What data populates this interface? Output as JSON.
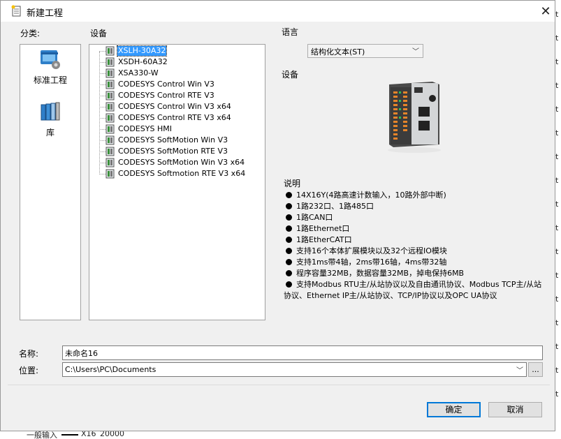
{
  "window": {
    "title": "新建工程"
  },
  "labels": {
    "category": "分类:",
    "device": "设备",
    "language": "语言",
    "device_preview": "设备",
    "name": "名称:",
    "location": "位置:"
  },
  "categories": [
    {
      "label": "标准工程",
      "icon": "standard-project-icon"
    },
    {
      "label": "库",
      "icon": "library-books-icon"
    }
  ],
  "devices": [
    "XSLH-30A32",
    "XSDH-60A32",
    "XSA330-W",
    "CODESYS Control Win V3",
    "CODESYS Control RTE V3",
    "CODESYS Control Win V3 x64",
    "CODESYS Control RTE V3 x64",
    "CODESYS HMI",
    "CODESYS SoftMotion Win V3",
    "CODESYS SoftMotion RTE V3",
    "CODESYS SoftMotion Win V3 x64",
    "CODESYS Softmotion RTE V3 x64"
  ],
  "selected_device": "XSLH-30A32",
  "language_select": {
    "value": "结构化文本(ST)"
  },
  "description": {
    "title": "说明",
    "bullets": [
      "14X16Y(4路高速计数输入，10路外部中断)",
      "1路232口、1路485口",
      "1路CAN口",
      "1路Ethernet口",
      "1路EtherCAT口",
      "支持16个本体扩展模块以及32个远程IO模块",
      "支持1ms带4轴，2ms带16轴，4ms带32轴",
      "程序容量32MB，数据容量32MB，掉电保持6MB",
      "支持Modbus RTU主/从站协议以及自由通讯协议、Modbus TCP主/从站协议、Ethernet IP主/从站协议、TCP/IP协议以及OPC UA协议"
    ]
  },
  "name_field": {
    "value": "未命名16"
  },
  "location_field": {
    "value": "C:\\Users\\PC\\Documents"
  },
  "buttons": {
    "browse": "...",
    "ok": "确定",
    "cancel": "取消"
  },
  "background": {
    "right_edge": [
      "t",
      "t",
      "t",
      "t",
      "t",
      "t",
      "t",
      "t",
      "t",
      "t",
      "t",
      "t",
      "t",
      "t",
      "t",
      "t",
      "t"
    ],
    "bottom": [
      "一般输入",
      "X16",
      "20000"
    ]
  },
  "colors": {
    "selection": "#3399ff",
    "primary_border": "#0078d7",
    "dialog_bg": "#f0f0f0"
  }
}
